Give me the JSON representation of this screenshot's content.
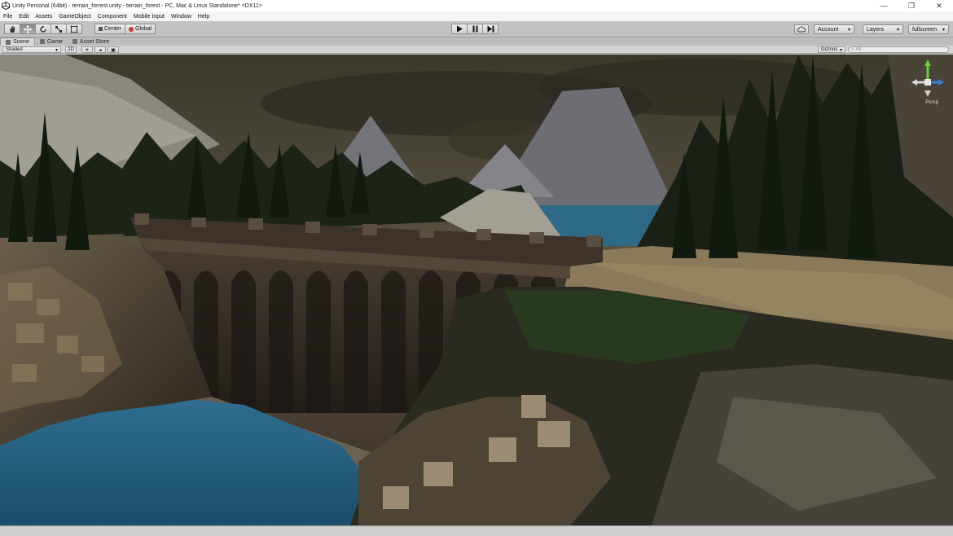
{
  "window": {
    "title": "Unity Personal (64bit) - terrain_forrest.unity - terrain_forest - PC, Mac & Linux Standalone* <DX11>",
    "minimize": "—",
    "maximize": "❐",
    "close": "✕"
  },
  "menu": [
    "File",
    "Edit",
    "Assets",
    "GameObject",
    "Component",
    "Mobile Input",
    "Window",
    "Help"
  ],
  "toolbar": {
    "tools": [
      "hand-tool",
      "move-tool",
      "rotate-tool",
      "scale-tool",
      "rect-tool"
    ],
    "active_tool": "move-tool",
    "pivot_label": "Center",
    "space_label": "Global",
    "account_label": "Account",
    "layers_label": "Layers",
    "layout_label": "fullscreen"
  },
  "tabs": [
    {
      "label": "Scene",
      "active": true
    },
    {
      "label": "Game",
      "active": false
    },
    {
      "label": "Asset Store",
      "active": false
    }
  ],
  "scene_view": {
    "draw_mode": "Shaded",
    "mode_2d": "2D",
    "gizmos_label": "Gizmos",
    "search_placeholder": "All",
    "persp_label": "Persp"
  },
  "colors": {
    "accent_active": "#8a8a8a",
    "sky": "#4a4536",
    "water": "#2b6c8f"
  }
}
